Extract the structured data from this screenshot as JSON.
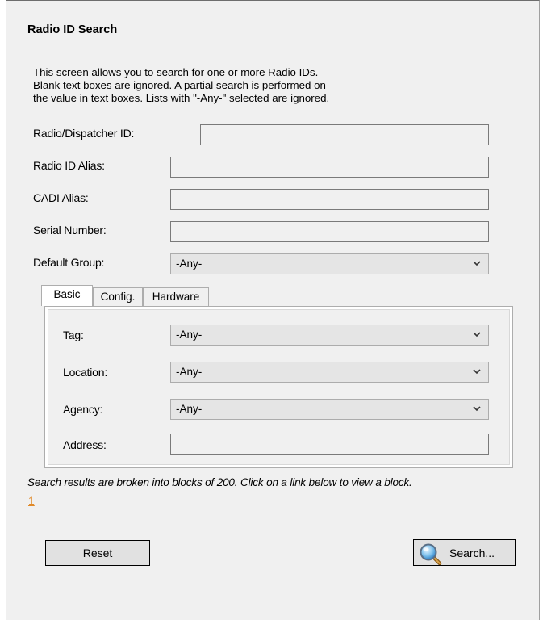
{
  "header": {
    "title": "Radio ID Search"
  },
  "description": {
    "line1": "This screen allows you to search for one or more Radio IDs.",
    "line2": "Blank text boxes are ignored.  A partial search is performed on",
    "line3": "the value in text boxes.  Lists with \"-Any-\" selected are ignored."
  },
  "fields": {
    "radio_dispatcher_id": {
      "label": "Radio/Dispatcher ID:",
      "value": ""
    },
    "radio_id_alias": {
      "label": "Radio ID Alias:",
      "value": ""
    },
    "cadi_alias": {
      "label": "CADI Alias:",
      "value": ""
    },
    "serial_number": {
      "label": "Serial Number:",
      "value": ""
    },
    "default_group": {
      "label": "Default Group:",
      "selected": "-Any-"
    }
  },
  "tabs": [
    {
      "label": "Basic",
      "active": true
    },
    {
      "label": "Config.",
      "active": false
    },
    {
      "label": "Hardware",
      "active": false
    }
  ],
  "basic_tab": {
    "tag": {
      "label": "Tag:",
      "selected": "-Any-"
    },
    "location": {
      "label": "Location:",
      "selected": "-Any-"
    },
    "agency": {
      "label": "Agency:",
      "selected": "-Any-"
    },
    "address": {
      "label": "Address:",
      "value": ""
    }
  },
  "results": {
    "note": "Search results are broken into blocks of 200.  Click on a link below to view a block.",
    "block_links": [
      "1"
    ]
  },
  "buttons": {
    "reset": "Reset",
    "search": "Search..."
  },
  "icons": {
    "search_button_icon": "magnifier-icon",
    "dropdown_icon": "chevron-down-icon"
  },
  "colors": {
    "panel_bg": "#f0f0f0",
    "link": "#e08a2a",
    "tab_page_bg": "#ffffff"
  }
}
